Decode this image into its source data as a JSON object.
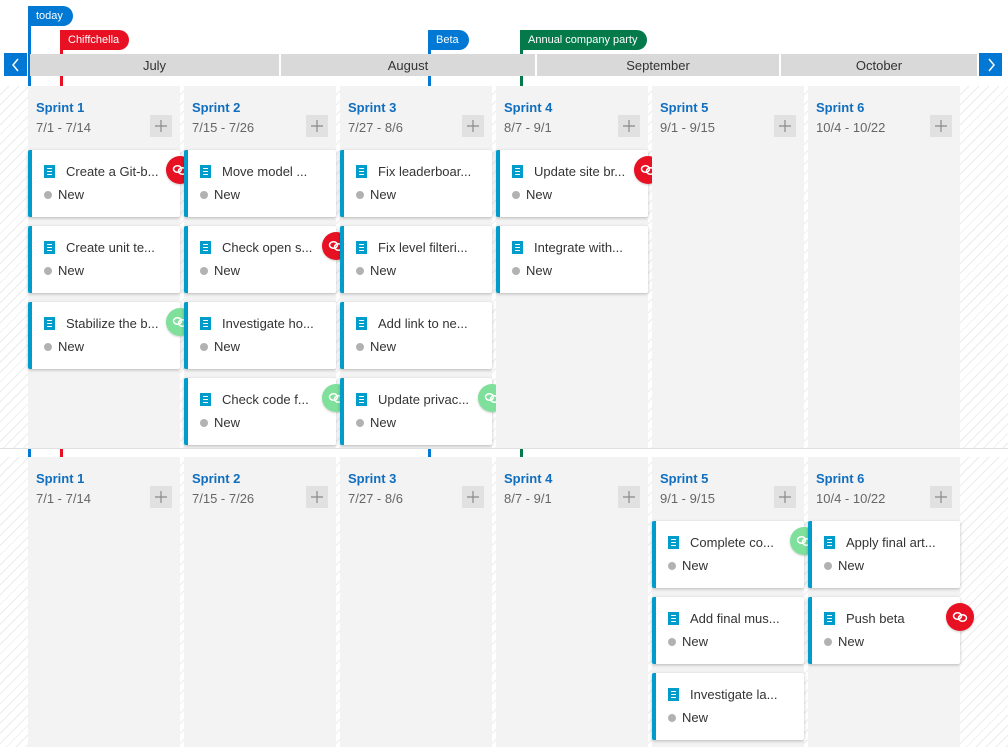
{
  "colors": {
    "accent": "#0078d4",
    "sprint_title": "#106ebe",
    "card_border": "#009ccc",
    "dep_error": "#e81123",
    "dep_ok": "#7ee09a",
    "state_new": "#b2b2b2"
  },
  "markers": [
    {
      "label": "today",
      "color": "#0078d4"
    },
    {
      "label": "Chiffchella",
      "color": "#e81123"
    },
    {
      "label": "Beta",
      "color": "#0078d4"
    },
    {
      "label": "Annual company party",
      "color": "#047a4a"
    }
  ],
  "nav": {
    "prev_icon": "chevron-left-icon",
    "next_icon": "chevron-right-icon"
  },
  "months": [
    "July",
    "August",
    "September",
    "October"
  ],
  "rows": [
    {
      "sprints": [
        {
          "name": "Sprint 1",
          "dates": "7/1 - 7/14",
          "cards": [
            {
              "title": "Create a Git-b...",
              "state": "New",
              "dependency": "error"
            },
            {
              "title": "Create unit te...",
              "state": "New",
              "dependency": null
            },
            {
              "title": "Stabilize the b...",
              "state": "New",
              "dependency": "ok"
            }
          ]
        },
        {
          "name": "Sprint 2",
          "dates": "7/15 - 7/26",
          "cards": [
            {
              "title": "Move model ...",
              "state": "New",
              "dependency": null
            },
            {
              "title": "Check open s...",
              "state": "New",
              "dependency": "error"
            },
            {
              "title": "Investigate ho...",
              "state": "New",
              "dependency": null
            },
            {
              "title": "Check code f...",
              "state": "New",
              "dependency": "ok"
            }
          ]
        },
        {
          "name": "Sprint 3",
          "dates": "7/27 - 8/6",
          "cards": [
            {
              "title": "Fix leaderboar...",
              "state": "New",
              "dependency": null
            },
            {
              "title": "Fix level filteri...",
              "state": "New",
              "dependency": null
            },
            {
              "title": "Add link to ne...",
              "state": "New",
              "dependency": null
            },
            {
              "title": "Update privac...",
              "state": "New",
              "dependency": "ok"
            }
          ]
        },
        {
          "name": "Sprint 4",
          "dates": "8/7 - 9/1",
          "cards": [
            {
              "title": "Update site br...",
              "state": "New",
              "dependency": "error"
            },
            {
              "title": "Integrate with...",
              "state": "New",
              "dependency": null
            }
          ]
        },
        {
          "name": "Sprint 5",
          "dates": "9/1 - 9/15",
          "cards": []
        },
        {
          "name": "Sprint 6",
          "dates": "10/4 - 10/22",
          "cards": []
        }
      ]
    },
    {
      "sprints": [
        {
          "name": "Sprint 1",
          "dates": "7/1 - 7/14",
          "cards": []
        },
        {
          "name": "Sprint 2",
          "dates": "7/15 - 7/26",
          "cards": []
        },
        {
          "name": "Sprint 3",
          "dates": "7/27 - 8/6",
          "cards": []
        },
        {
          "name": "Sprint 4",
          "dates": "8/7 - 9/1",
          "cards": []
        },
        {
          "name": "Sprint 5",
          "dates": "9/1 - 9/15",
          "cards": [
            {
              "title": "Complete co...",
              "state": "New",
              "dependency": "ok"
            },
            {
              "title": "Add final mus...",
              "state": "New",
              "dependency": null
            },
            {
              "title": "Investigate la...",
              "state": "New",
              "dependency": null
            }
          ]
        },
        {
          "name": "Sprint 6",
          "dates": "10/4 - 10/22",
          "cards": [
            {
              "title": "Apply final art...",
              "state": "New",
              "dependency": null
            },
            {
              "title": "Push beta",
              "state": "New",
              "dependency": "error"
            }
          ]
        }
      ]
    }
  ]
}
